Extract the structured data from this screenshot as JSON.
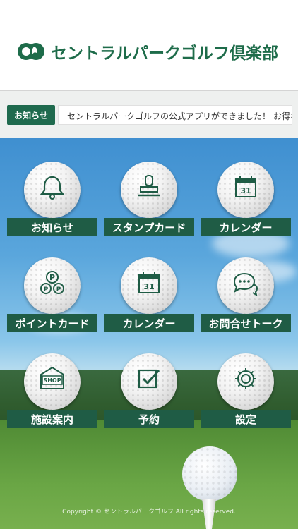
{
  "header": {
    "app_name": "セントラルパークゴルフ倶楽部",
    "brand_color": "#1e6c4a"
  },
  "notice": {
    "label": "お知らせ",
    "message": "セントラルパークゴルフの公式アプリができました！ お得な情報やお"
  },
  "menu": [
    {
      "label": "お知らせ",
      "icon": "bell-icon"
    },
    {
      "label": "スタンプカード",
      "icon": "stamp-icon"
    },
    {
      "label": "カレンダー",
      "icon": "calendar-icon",
      "icon_text": "31"
    },
    {
      "label": "ポイントカード",
      "icon": "points-icon",
      "icon_text": "P"
    },
    {
      "label": "カレンダー",
      "icon": "calendar-icon",
      "icon_text": "31"
    },
    {
      "label": "お問合せトーク",
      "icon": "chat-icon"
    },
    {
      "label": "施設案内",
      "icon": "shop-icon",
      "icon_text": "SHOP"
    },
    {
      "label": "予約",
      "icon": "checkbox-icon"
    },
    {
      "label": "設定",
      "icon": "gear-icon"
    }
  ],
  "footer": {
    "copyright": "Copyright © セントラルパークゴルフ All rights reserved."
  }
}
